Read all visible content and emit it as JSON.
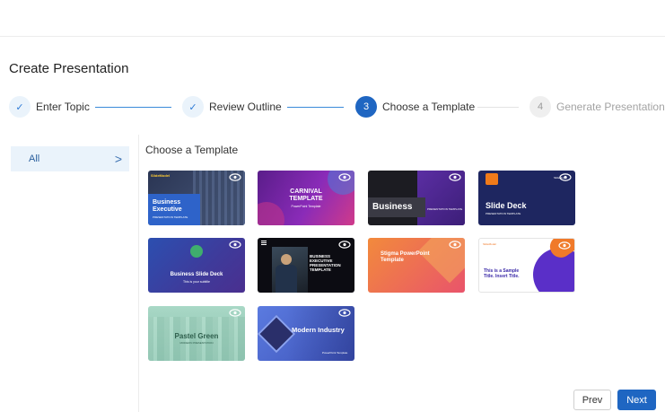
{
  "page": {
    "title": "Create Presentation"
  },
  "stepper": {
    "steps": [
      {
        "label": "Enter Topic",
        "state": "done",
        "marker": "✓"
      },
      {
        "label": "Review Outline",
        "state": "done",
        "marker": "✓"
      },
      {
        "label": "Choose a Template",
        "state": "active",
        "marker": "3"
      },
      {
        "label": "Generate Presentation",
        "state": "todo",
        "marker": "4"
      }
    ]
  },
  "sidebar": {
    "items": [
      {
        "label": "All",
        "chevron": ">"
      }
    ]
  },
  "section": {
    "title": "Choose a Template"
  },
  "templates": [
    {
      "text": "Business Executive",
      "brand": "SlideModel",
      "subtitle": "PRESENTATION TEMPLATE"
    },
    {
      "text": "CARNIVAL TEMPLATE",
      "subtitle": "PowerPoint Template"
    },
    {
      "text": "Business",
      "subtitle": "PRESENTATION TEMPLATE"
    },
    {
      "text": "Slide Deck",
      "brand": "SlideModel",
      "subtitle": "PRESENTATION TEMPLATE"
    },
    {
      "text": "Business Slide Deck",
      "subtitle": "This is your subtitle"
    },
    {
      "text": "BUSINESS EXECUTIVE PRESENTATION TEMPLATE"
    },
    {
      "text": "Stigma PowerPoint Template"
    },
    {
      "text": "This is a Sample Title. Insert Title.",
      "brand": "SlideModel"
    },
    {
      "text": "Pastel Green",
      "subtitle": "MODERN PRESENTATION"
    },
    {
      "text": "Modern Industry",
      "subtitle": "PowerPoint Template"
    }
  ],
  "buttons": {
    "prev": "Prev",
    "next": "Next"
  },
  "colors": {
    "accent": "#1f66c2",
    "line": "#3b8ad9"
  }
}
